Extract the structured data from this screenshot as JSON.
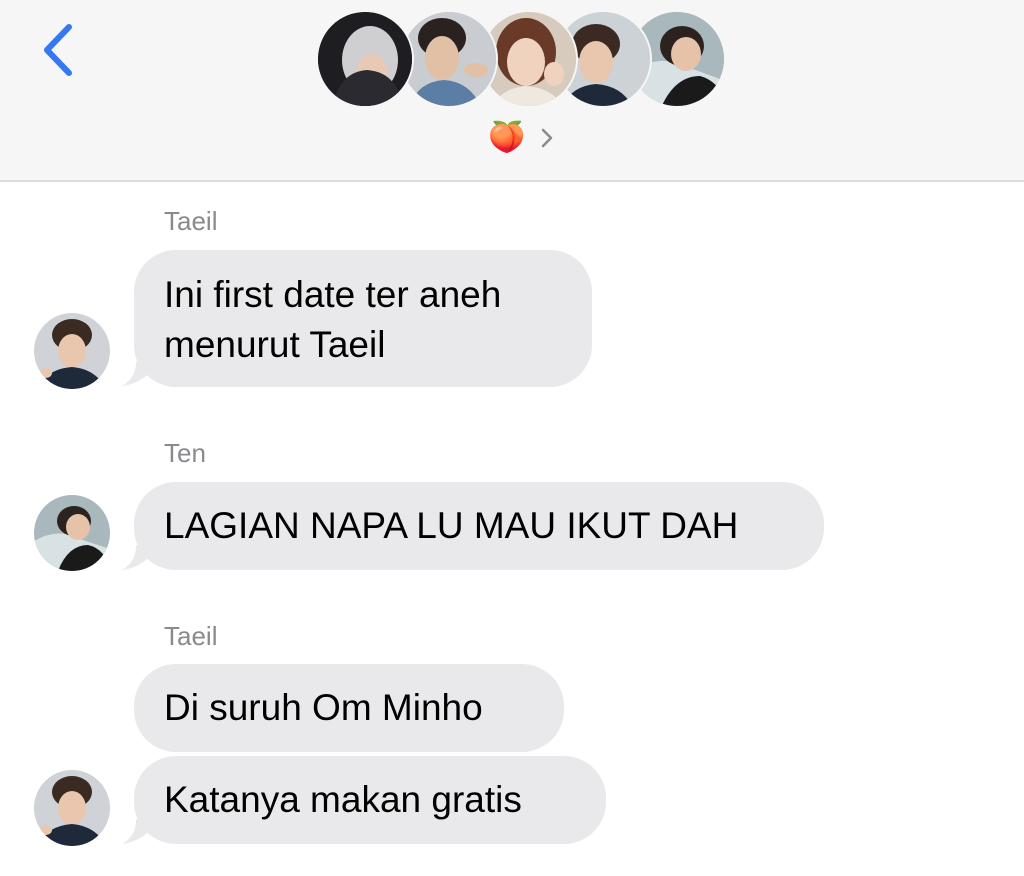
{
  "header": {
    "back_icon": "chevron-left-icon",
    "group_emoji": "🍑",
    "chevron_icon": "chevron-right-icon",
    "participants": [
      {
        "avatar": "member-avatar-1"
      },
      {
        "avatar": "member-avatar-2"
      },
      {
        "avatar": "member-avatar-3"
      },
      {
        "avatar": "member-avatar-4"
      },
      {
        "avatar": "member-avatar-5"
      }
    ],
    "accent_color": "#3478f6"
  },
  "messages": [
    {
      "sender": "Taeil",
      "lines": [
        "Ini first date ter aneh",
        "menurut Taeil"
      ]
    },
    {
      "sender": "Ten",
      "text": "LAGIAN NAPA LU MAU IKUT DAH"
    },
    {
      "sender": "Taeil",
      "text": "Di suruh Om Minho"
    },
    {
      "sender": "",
      "text": "Katanya makan gratis"
    }
  ],
  "colors": {
    "bubble_incoming": "#e9e9eb",
    "sender_name": "#8a8a8e",
    "header_bg": "#f6f6f6"
  }
}
